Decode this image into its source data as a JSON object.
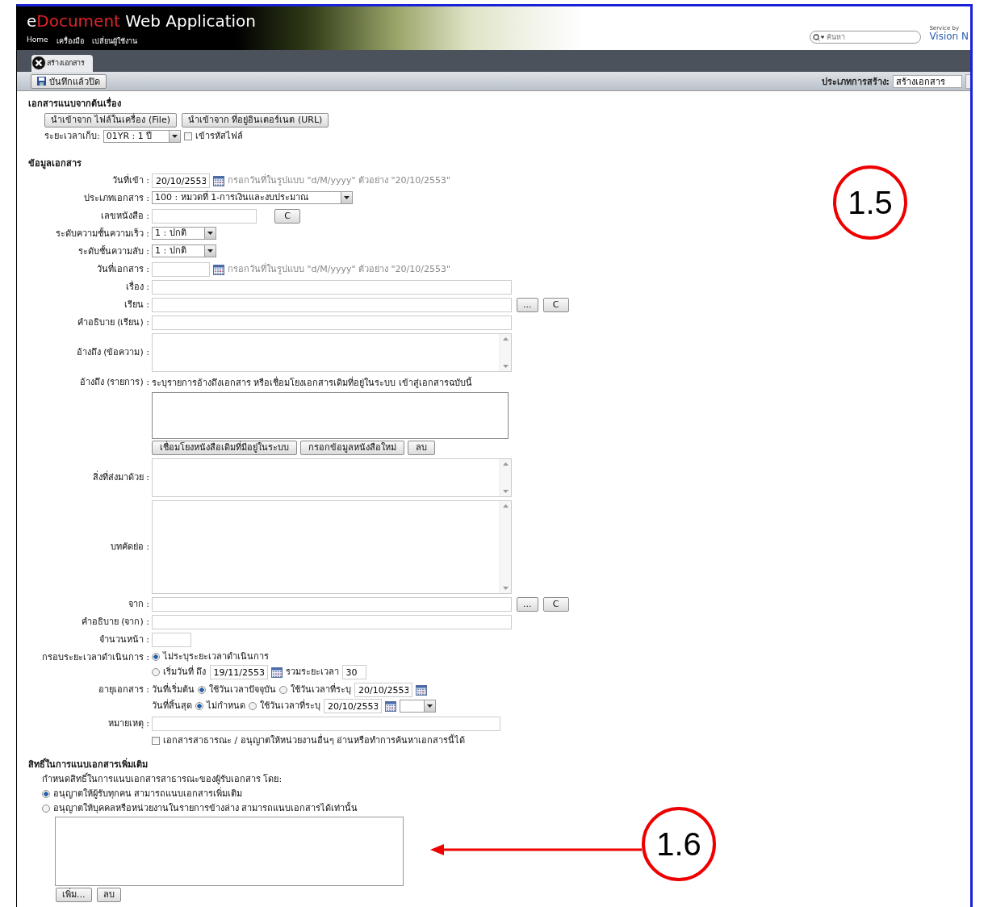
{
  "header": {
    "title_parts": [
      {
        "text": "e",
        "accent": false
      },
      {
        "text": "Document",
        "accent": true
      },
      {
        "text": " Web Application",
        "accent": false
      }
    ],
    "menu": [
      "Home",
      "เครื่องมือ",
      "เปลี่ยนผู้ใช้งาน"
    ],
    "search": {
      "placeholder": "ค้นหา"
    },
    "brand": {
      "line1": "Service by",
      "line2": "Vision N"
    }
  },
  "tabs": [
    {
      "label": "สร้างเอกสาร",
      "selected": true
    }
  ],
  "toolbar": {
    "save_button": "บันทึกแล้วปิด",
    "create_type_label": "ประเภทการสร้าง:",
    "create_type_value": "สร้างเอกสาร"
  },
  "attachments": {
    "title": "เอกสารแนบจากต้นเรื่อง",
    "buttons": [
      "นำเข้าจาก ไฟล์ในเครื่อง (File)",
      "นำเข้าจาก ที่อยู่อินเตอร์เนต (URL)"
    ],
    "retention_label": "ระยะเวลาเก็บ:",
    "retention_value": "01YR : 1 ปี",
    "encrypt": {
      "label": "เข้ารหัสไฟล์",
      "checked": false
    }
  },
  "document_info": {
    "title": "ข้อมูลเอกสาร",
    "fields": [
      {
        "kind": "date",
        "label": "วันที่เข้า :",
        "value": "20/10/2553",
        "hint": "กรอกวันที่ในรูปแบบ \"d/M/yyyy\" ตัวอย่าง \"20/10/2553\""
      },
      {
        "kind": "wideselect",
        "label": "ประเภทเอกสาร :",
        "value": "100 : หมวดที่ 1-การเงินและงบประมาณ"
      },
      {
        "kind": "shorttext",
        "label": "เลขหนังสือ :",
        "buttons": [
          "C"
        ]
      },
      {
        "kind": "select",
        "label": "ระดับความชั้นความเร็ว :",
        "value": "1 : ปกติ"
      },
      {
        "kind": "select",
        "label": "ระดับชั้นความลับ :",
        "value": "1 : ปกติ"
      },
      {
        "kind": "date",
        "label": "วันที่เอกสาร :",
        "hint": "กรอกวันที่ในรูปแบบ \"d/M/yyyy\" ตัวอย่าง \"20/10/2553\""
      },
      {
        "kind": "text",
        "label": "เรื่อง :"
      },
      {
        "kind": "text",
        "label": "เรียน :",
        "buttons": [
          "...",
          "C"
        ]
      },
      {
        "kind": "text",
        "label": "คำอธิบาย (เรียน) :"
      },
      {
        "kind": "textarea",
        "label": "อ้างถึง (ข้อความ) :"
      },
      {
        "kind": "reflist",
        "label": "อ้างถึง (รายการ) :",
        "note": "ระบุรายการอ้างถึงเอกสาร หรือเชื่อมโยงเอกสารเดิมที่อยู่ในระบบ เข้าสู่เอกสารฉบับนี้",
        "buttons": [
          "เชื่อมโยงหนังสือเดิมที่มีอยู่ในระบบ",
          "กรอกข้อมูลหนังสือใหม่",
          "ลบ"
        ]
      },
      {
        "kind": "textarea",
        "label": "สิ่งที่ส่งมาด้วย :"
      },
      {
        "kind": "tallarea",
        "label": "บทคัดย่อ :"
      },
      {
        "kind": "text",
        "label": "จาก :",
        "buttons": [
          "...",
          "C"
        ]
      },
      {
        "kind": "text",
        "label": "คำอธิบาย (จาก) :"
      },
      {
        "kind": "number",
        "label": "จำนวนหน้า :"
      },
      {
        "kind": "period",
        "label": "กรอบระยะเวลาดำเนินการ :",
        "options": [
          {
            "label": "ไม่ระบุระยะเวลาดำเนินการ",
            "selected": true
          },
          {
            "label": "เริ่มวันที่ ถึง",
            "selected": false,
            "date": "19/11/2553",
            "total_label": "รวมระยะเวลา",
            "total": "30"
          }
        ]
      },
      {
        "kind": "age",
        "label": "อายุเอกสาร :",
        "lines": [
          {
            "label": "วันที่เริ่มต้น",
            "options": [
              {
                "label": "ใช้วันเวลาปัจจุบัน",
                "selected": true
              },
              {
                "label": "ใช้วันเวลาที่ระบุ",
                "selected": false
              }
            ],
            "date": "20/10/2553",
            "time_select": false
          },
          {
            "label": "วันที่สิ้นสุด",
            "options": [
              {
                "label": "ไม่กำหนด",
                "selected": true
              },
              {
                "label": "ใช้วันเวลาที่ระบุ",
                "selected": false
              }
            ],
            "date": "20/10/2553",
            "time_select": true
          }
        ]
      },
      {
        "kind": "note",
        "label": "หมายเหตุ :"
      },
      {
        "kind": "checkbox",
        "text": "เอกสารสาธารณะ / อนุญาตให้หน่วยงานอื่นๆ อ่านหรือทำการค้นหาเอกสารนี้ได้",
        "checked": false
      }
    ]
  },
  "attach_rights": {
    "title": "สิทธิ์ในการแนบเอกสารเพิ่มเติม",
    "subtitle": "กำหนดสิทธิ์ในการแนบเอกสารสาธารณะของผู้รับเอกสาร โดย:",
    "options": [
      {
        "label": "อนุญาตให้ผู้รับทุกคน สามารถแนบเอกสารเพิ่มเติม",
        "selected": true
      },
      {
        "label": "อนุญาตให้บุคคลหรือหน่วยงานในรายการข้างล่าง สามารถแนบเอกสารได้เท่านั้น",
        "selected": false
      }
    ],
    "buttons": [
      "เพิ่ม...",
      "ลบ"
    ]
  },
  "callouts": [
    {
      "label": "1.5",
      "arrow": false
    },
    {
      "label": "1.6",
      "arrow": true
    }
  ]
}
